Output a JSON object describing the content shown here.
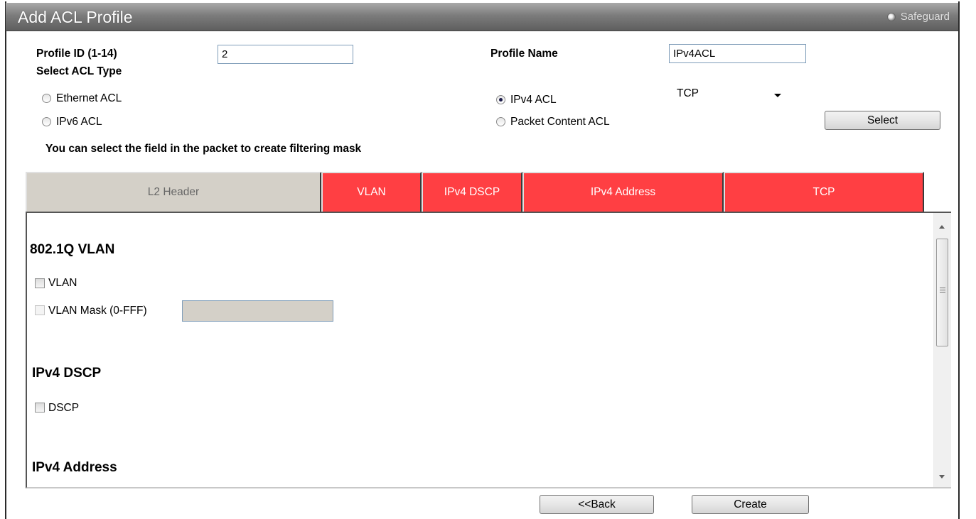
{
  "window": {
    "title": "Add ACL Profile",
    "safeguard_label": "Safeguard"
  },
  "form": {
    "profile_id_label": "Profile ID (1-14)",
    "profile_id_value": "2",
    "profile_name_label": "Profile Name",
    "profile_name_value": "IPv4ACL",
    "acl_type_label": "Select ACL Type",
    "acl_types": {
      "ethernet": "Ethernet ACL",
      "ipv6": "IPv6 ACL",
      "ipv4": "IPv4 ACL",
      "packet_content": "Packet Content ACL"
    },
    "selected_acl_type": "IPv4 ACL",
    "protocol_value": "TCP",
    "select_button": "Select",
    "hint": "You can select the field in the packet to create filtering mask"
  },
  "tabs": [
    "L2 Header",
    "VLAN",
    "IPv4 DSCP",
    "IPv4 Address",
    "TCP"
  ],
  "sections": {
    "vlan": {
      "title": "802.1Q VLAN",
      "vlan_label": "VLAN",
      "mask_label": "VLAN Mask (0-FFF)",
      "mask_value": ""
    },
    "dscp": {
      "title": "IPv4 DSCP",
      "dscp_label": "DSCP"
    },
    "address": {
      "title": "IPv4 Address"
    }
  },
  "buttons": {
    "back": "<<Back",
    "create": "Create"
  },
  "colors": {
    "tab_active": "#ff3f43",
    "tab_inactive": "#d4d0c8",
    "titlebar": "#7c7c7c"
  }
}
